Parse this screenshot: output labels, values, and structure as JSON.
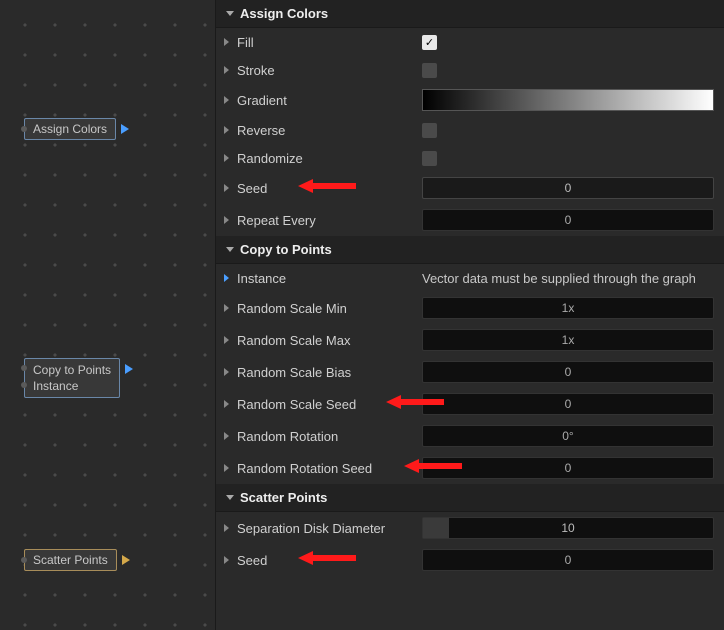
{
  "graph": {
    "nodes": {
      "assign_colors": {
        "label": "Assign Colors",
        "arrow_color": "#4a9eff"
      },
      "copy_to_points": {
        "label": "Copy to Points",
        "arrow_color": "#4a9eff"
      },
      "instance": {
        "label": "Instance"
      },
      "scatter_points": {
        "label": "Scatter Points",
        "arrow_color": "#d4a84a"
      }
    }
  },
  "sections": {
    "assign_colors": {
      "title": "Assign Colors",
      "props": {
        "fill": {
          "label": "Fill",
          "checked": true
        },
        "stroke": {
          "label": "Stroke"
        },
        "gradient": {
          "label": "Gradient"
        },
        "reverse": {
          "label": "Reverse"
        },
        "randomize": {
          "label": "Randomize"
        },
        "seed": {
          "label": "Seed",
          "value": "0"
        },
        "repeat_every": {
          "label": "Repeat Every",
          "value": "0"
        }
      }
    },
    "copy_to_points": {
      "title": "Copy to Points",
      "props": {
        "instance": {
          "label": "Instance",
          "info": "Vector data must be supplied through the graph"
        },
        "random_scale_min": {
          "label": "Random Scale Min",
          "value": "1x"
        },
        "random_scale_max": {
          "label": "Random Scale Max",
          "value": "1x"
        },
        "random_scale_bias": {
          "label": "Random Scale Bias",
          "value": "0"
        },
        "random_scale_seed": {
          "label": "Random Scale Seed",
          "value": "0"
        },
        "random_rotation": {
          "label": "Random Rotation",
          "value": "0°"
        },
        "random_rotation_seed": {
          "label": "Random Rotation Seed",
          "value": "0"
        }
      }
    },
    "scatter_points": {
      "title": "Scatter Points",
      "props": {
        "separation": {
          "label": "Separation Disk Diameter",
          "value": "10"
        },
        "seed": {
          "label": "Seed",
          "value": "0"
        }
      }
    }
  }
}
